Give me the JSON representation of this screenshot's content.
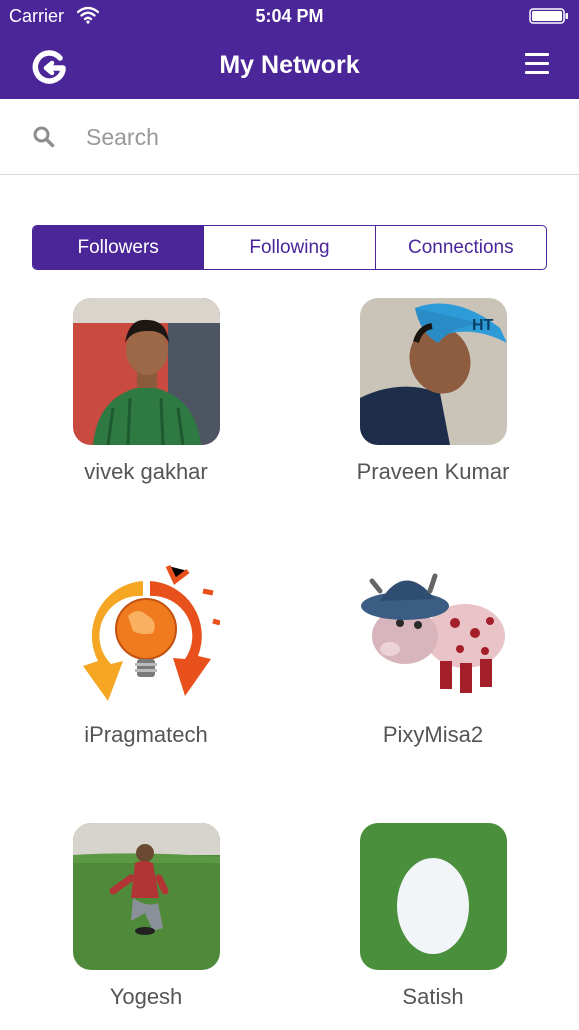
{
  "status_bar": {
    "carrier": "Carrier",
    "time": "5:04 PM"
  },
  "navbar": {
    "title": "My Network",
    "logo_icon": "g-logo-icon",
    "menu_icon": "hamburger-menu-icon"
  },
  "search": {
    "placeholder": "Search",
    "value": "",
    "icon": "search-icon"
  },
  "tabs": [
    {
      "label": "Followers",
      "active": true
    },
    {
      "label": "Following",
      "active": false
    },
    {
      "label": "Connections",
      "active": false
    }
  ],
  "people": [
    {
      "name": "vivek gakhar"
    },
    {
      "name": "Praveen Kumar"
    },
    {
      "name": "iPragmatech"
    },
    {
      "name": "PixyMisa2"
    },
    {
      "name": "Yogesh"
    },
    {
      "name": "Satish"
    }
  ],
  "colors": {
    "brand": "#4a2699",
    "default_avatar_bg": "#4a8f3c",
    "egg": "#f2f5f8"
  }
}
